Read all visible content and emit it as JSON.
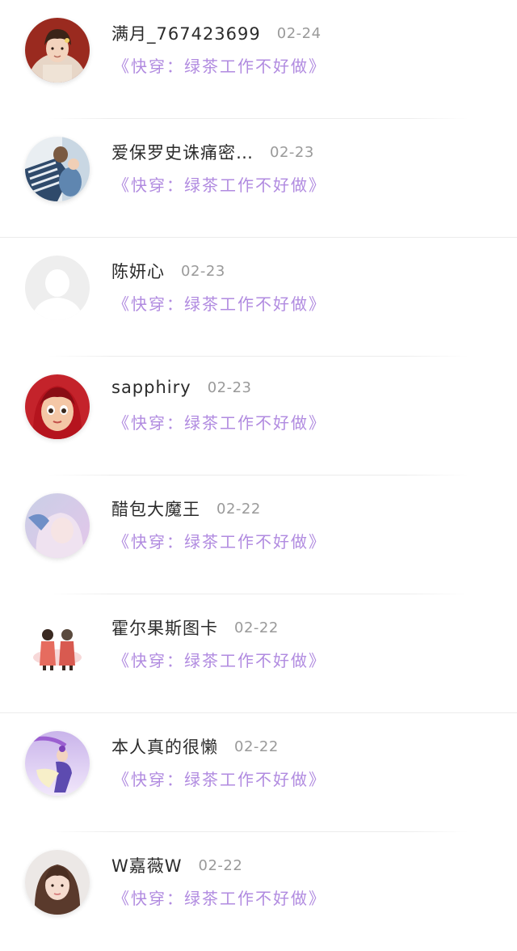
{
  "comments": [
    {
      "name": "满月_767423699",
      "date": "02-24",
      "book": "《快穿：绿茶工作不好做》",
      "avatar": "avatar-boy-portrait"
    },
    {
      "name": "爱保罗史诛痛密…",
      "date": "02-23",
      "book": "《快穿：绿茶工作不好做》",
      "avatar": "avatar-couple-hug"
    },
    {
      "name": "陈妍心",
      "date": "02-23",
      "book": "《快穿：绿茶工作不好做》",
      "avatar": "avatar-default-placeholder"
    },
    {
      "name": "sapphiry",
      "date": "02-23",
      "book": "《快穿：绿茶工作不好做》",
      "avatar": "avatar-cartoon-girl"
    },
    {
      "name": "醋包大魔王",
      "date": "02-22",
      "book": "《快穿：绿茶工作不好做》",
      "avatar": "avatar-pastel-girl"
    },
    {
      "name": "霍尔果斯图卡",
      "date": "02-22",
      "book": "《快穿：绿茶工作不好做》",
      "avatar": "avatar-two-figures"
    },
    {
      "name": "本人真的很懒",
      "date": "02-22",
      "book": "《快穿：绿茶工作不好做》",
      "avatar": "avatar-dancer"
    },
    {
      "name": "W嘉薇W",
      "date": "02-22",
      "book": "《快穿：绿茶工作不好做》",
      "avatar": "avatar-woman-photo"
    }
  ],
  "colors": {
    "name": "#2b2b2b",
    "date": "#9a9a9a",
    "book_title": "#b18be0",
    "divider": "#ececec"
  }
}
